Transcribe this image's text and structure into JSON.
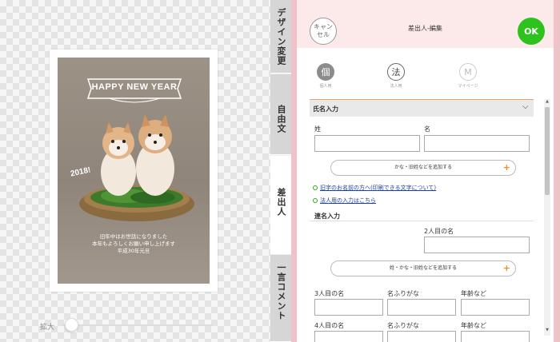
{
  "preview": {
    "card": {
      "banner": "HAPPY NEW YEAR",
      "year": "2018!",
      "greeting": [
        "旧年中はお世話になりました",
        "本年もよろしくお願い申し上げます",
        "平成30年元旦"
      ]
    },
    "zoom_label": "拡大",
    "zoom_level": 0.06
  },
  "tabs": [
    {
      "label": "デザイン変更",
      "active": false
    },
    {
      "label": "自由文",
      "active": false
    },
    {
      "label": "差出人",
      "active": true
    },
    {
      "label": "一言コメント",
      "active": false
    }
  ],
  "header": {
    "cancel_label": "キャンセル",
    "title": "差出人-編集",
    "ok_label": "OK"
  },
  "types": [
    {
      "glyph": "個",
      "label": "個人用",
      "selected": true
    },
    {
      "glyph": "法",
      "label": "法人用",
      "selected": false
    },
    {
      "glyph": "M",
      "label": "マイページ",
      "selected": false
    }
  ],
  "form": {
    "section_title": "氏名入力",
    "last_name_label": "姓",
    "first_name_label": "名",
    "add_kana_label": "かな・旧姓などを追加する",
    "links": [
      "旧字のお名前の方へ(印刷できる文字について)",
      "法人用の入力はこちら"
    ],
    "renmei_title": "連名入力",
    "second_name_label": "2人目の名",
    "add_kana_label_2": "姓・かな・旧姓などを追加する",
    "row3": [
      "3人目の名",
      "名ふりがな",
      "年齢など"
    ],
    "row4": [
      "4人目の名",
      "名ふりがな",
      "年齢など"
    ]
  },
  "colors": {
    "ok_green": "#2ec21e",
    "panel_pink": "#efc2c7",
    "header_pink": "#fce9ea",
    "plus_orange": "#ef8d2a",
    "link_blue": "#1c3fa5"
  }
}
